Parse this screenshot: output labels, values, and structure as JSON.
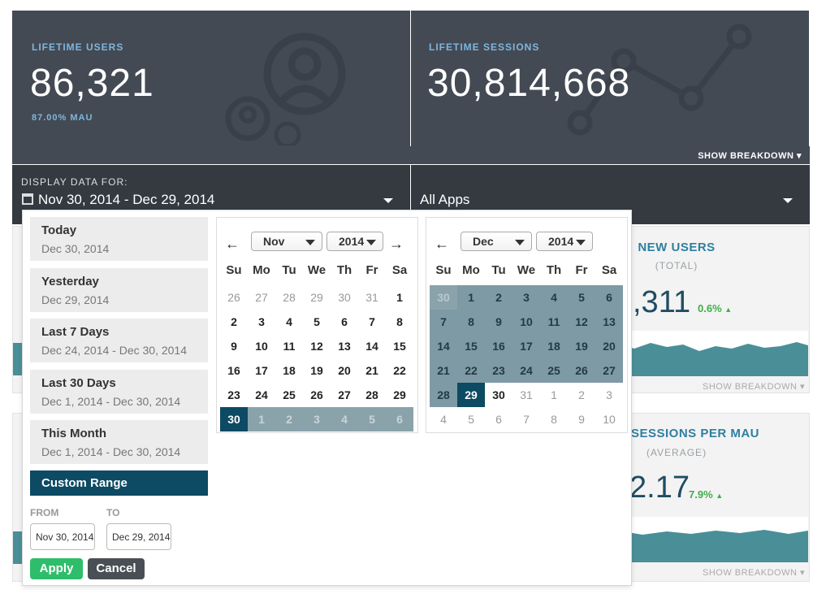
{
  "stats": {
    "users": {
      "label": "LIFETIME USERS",
      "value": "86,321",
      "sub": "87.00% MAU"
    },
    "sessions": {
      "label": "LIFETIME SESSIONS",
      "value": "30,814,668"
    }
  },
  "show_breakdown": "SHOW BREAKDOWN",
  "display_label": "DISPLAY DATA FOR:",
  "date_range": "Nov 30, 2014 - Dec 29, 2014",
  "apps": "All Apps",
  "cards": {
    "new_users": {
      "title": "NEW USERS",
      "sub": "(TOTAL)",
      "value": ",311",
      "delta": "0.6%",
      "breakdown": "SHOW BREAKDOWN"
    },
    "sessions_mau": {
      "title": "SESSIONS PER MAU",
      "sub": "(AVERAGE)",
      "value": "2.17",
      "delta": "7.9%",
      "breakdown": "SHOW BREAKDOWN"
    }
  },
  "ranges": [
    {
      "title": "Today",
      "dates": "Dec 30, 2014"
    },
    {
      "title": "Yesterday",
      "dates": "Dec 29, 2014"
    },
    {
      "title": "Last 7 Days",
      "dates": "Dec 24, 2014 - Dec 30, 2014"
    },
    {
      "title": "Last 30 Days",
      "dates": "Dec 1, 2014 - Dec 30, 2014"
    },
    {
      "title": "This Month",
      "dates": "Dec 1, 2014 - Dec 30, 2014"
    }
  ],
  "custom_range": "Custom Range",
  "from_label": "FROM",
  "to_label": "TO",
  "from_value": "Nov 30, 2014",
  "to_value": "Dec 29, 2014",
  "apply": "Apply",
  "cancel": "Cancel",
  "weekdays": [
    "Su",
    "Mo",
    "Tu",
    "We",
    "Th",
    "Fr",
    "Sa"
  ],
  "left_cal": {
    "month": "Nov",
    "year": "2014"
  },
  "right_cal": {
    "month": "Dec",
    "year": "2014"
  },
  "colors": {
    "accent": "#0d4a63",
    "range": "#7e9aa4",
    "apply": "#2ebd6b",
    "cancel": "#4a4f55",
    "panel": "#434a54"
  }
}
